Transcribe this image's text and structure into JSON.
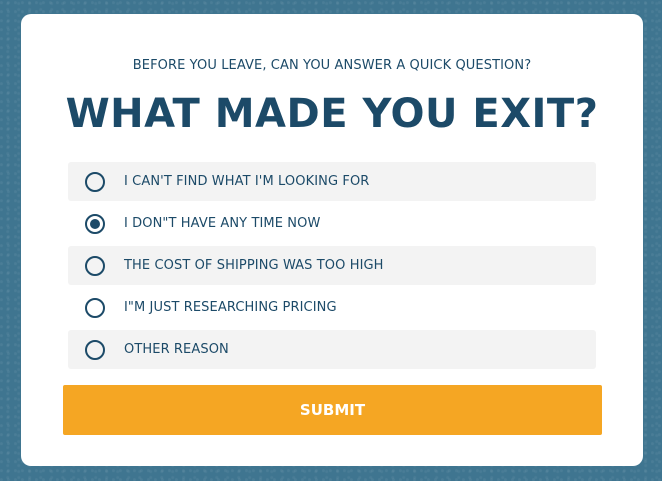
{
  "modal": {
    "subtitle": "BEFORE YOU LEAVE, CAN YOU ANSWER A QUICK QUESTION?",
    "title": "WHAT MADE YOU EXIT?",
    "options": [
      {
        "label": "I CAN'T FIND WHAT I'M LOOKING FOR",
        "selected": false
      },
      {
        "label": "I DON\"T HAVE ANY TIME NOW",
        "selected": true
      },
      {
        "label": "THE COST OF SHIPPING WAS TOO HIGH",
        "selected": false
      },
      {
        "label": "I\"M JUST RESEARCHING PRICING",
        "selected": false
      },
      {
        "label": "OTHER REASON",
        "selected": false
      }
    ],
    "submit_label": "SUBMIT"
  },
  "colors": {
    "background": "#3f7590",
    "text": "#1c4a68",
    "accent": "#f5a623",
    "row_shade": "#f3f3f3"
  }
}
